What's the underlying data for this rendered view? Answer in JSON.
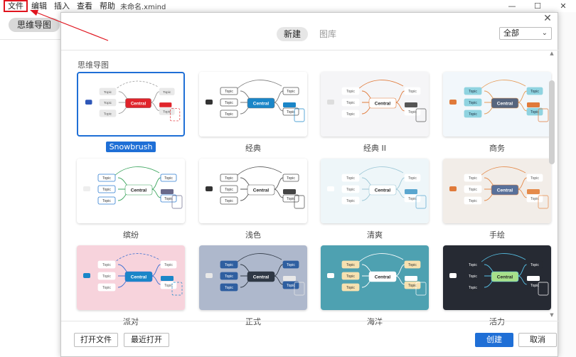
{
  "menubar": {
    "items": [
      "文件",
      "编辑",
      "插入",
      "查看",
      "帮助"
    ],
    "doc_title": "未命名.xmind"
  },
  "window": {
    "minimize": "—",
    "maximize": "☐",
    "close": "✕"
  },
  "sidebar": {
    "chip": "思维导图"
  },
  "dialog": {
    "close": "✕",
    "tabs": [
      {
        "label": "新建",
        "active": true
      },
      {
        "label": "图库",
        "active": false
      }
    ],
    "filter": {
      "value": "全部"
    },
    "section_title": "思维导图",
    "templates": [
      {
        "label": "Snowbrush",
        "selected": true
      },
      {
        "label": "经典",
        "selected": false
      },
      {
        "label": "经典 II",
        "selected": false
      },
      {
        "label": "商务",
        "selected": false
      },
      {
        "label": "缤纷",
        "selected": false
      },
      {
        "label": "浅色",
        "selected": false
      },
      {
        "label": "清爽",
        "selected": false
      },
      {
        "label": "手绘",
        "selected": false
      },
      {
        "label": "派对",
        "selected": false
      },
      {
        "label": "正式",
        "selected": false
      },
      {
        "label": "海洋",
        "selected": false
      },
      {
        "label": "活力",
        "selected": false
      }
    ],
    "card_text": {
      "central": "Central",
      "topic": "Topic"
    },
    "footer": {
      "open_file": "打开文件",
      "recent": "最近打开",
      "create": "创建",
      "cancel": "取消"
    }
  },
  "colors": {
    "accent": "#1f6fd6",
    "annotation": "#e0141e"
  }
}
